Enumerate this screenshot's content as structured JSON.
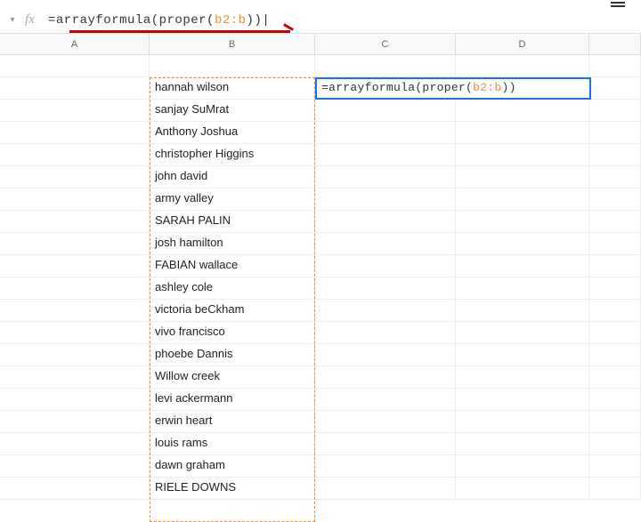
{
  "toolbar": {
    "fx_label": "fx"
  },
  "formula_bar": {
    "prefix": "=arrayformula(proper(",
    "range": "b2:b",
    "suffix": "))"
  },
  "active_cell": {
    "prefix": "=arrayformula(proper(",
    "range": "b2:b",
    "suffix": "))"
  },
  "columns": {
    "a": "A",
    "b": "B",
    "c": "C",
    "d": "D"
  },
  "col_b_values": [
    "",
    "hannah wilson",
    "sanjay SuMrat",
    "Anthony Joshua",
    "christopher Higgins",
    "john david",
    "army valley",
    "SARAH PALIN",
    "josh hamilton",
    "FABIAN wallace",
    "ashley cole",
    "victoria beCkham",
    "vivo francisco",
    "phoebe Dannis",
    "Willow creek",
    "levi ackermann",
    "erwin heart",
    "louis rams",
    "dawn graham",
    "RIELE DOWNS"
  ]
}
